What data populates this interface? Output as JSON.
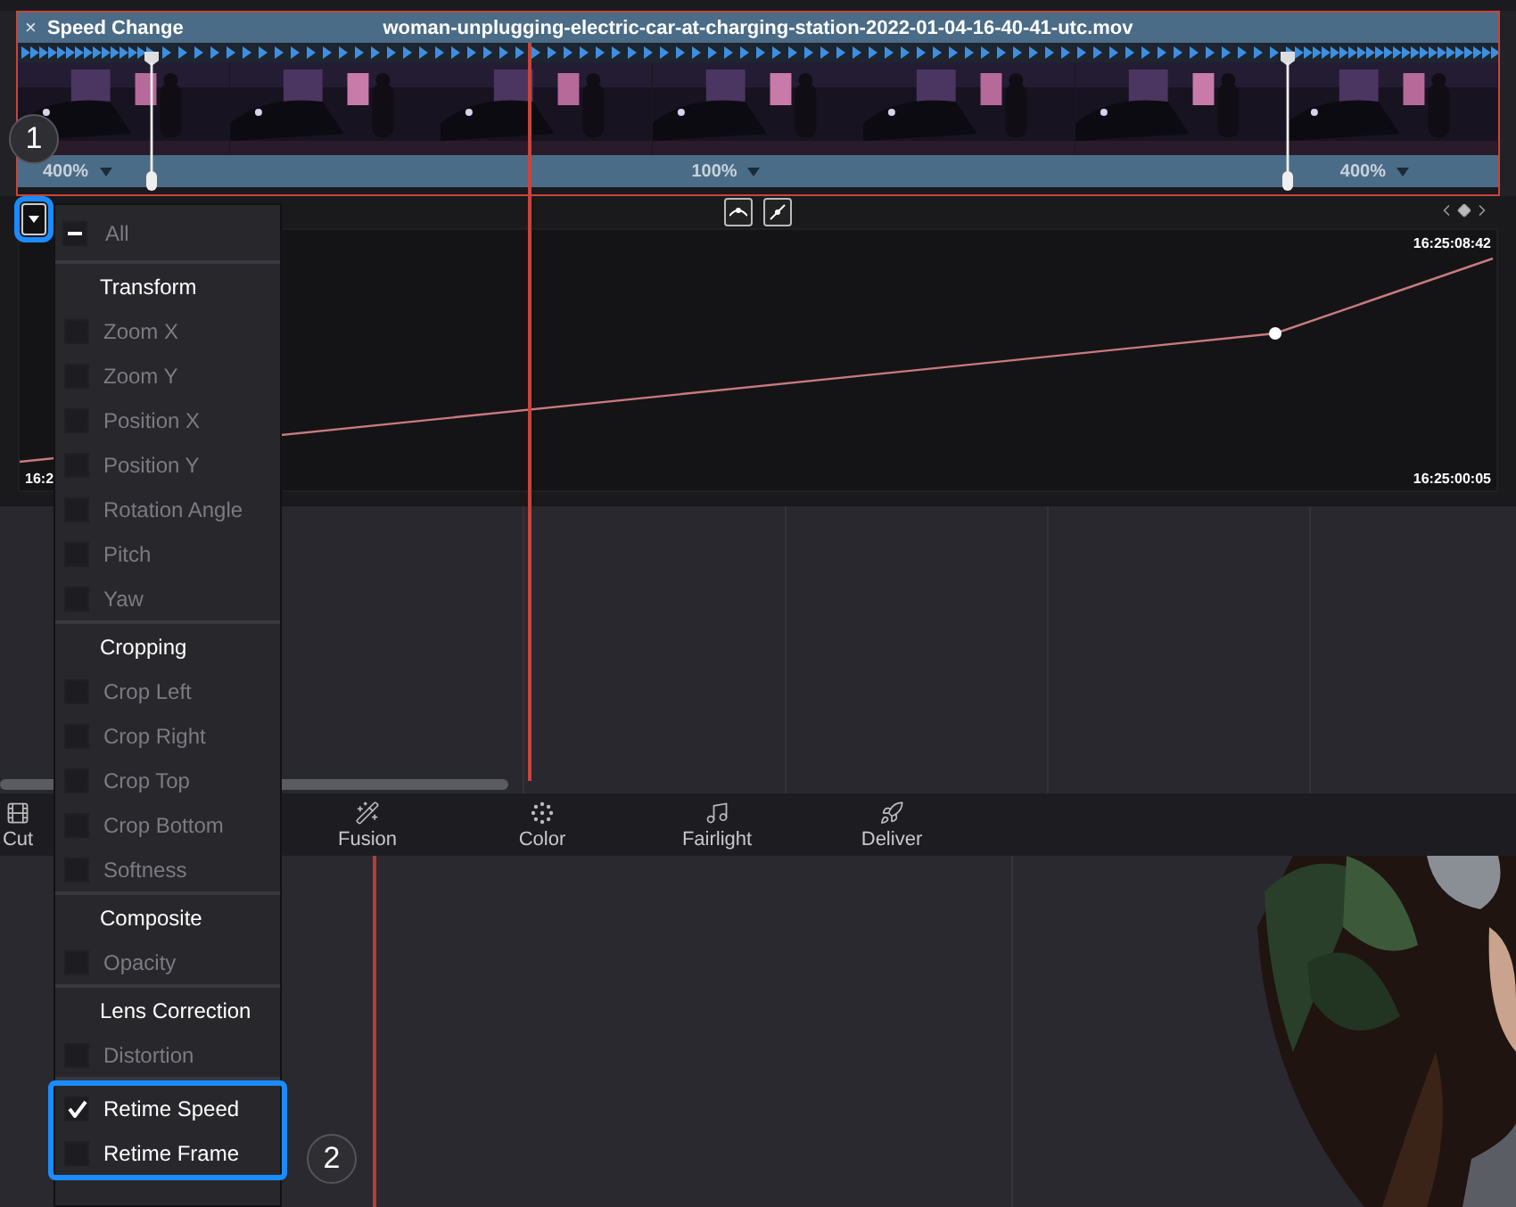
{
  "clip": {
    "close": "×",
    "title": "Speed Change",
    "filename": "woman-unplugging-electric-car-at-charging-station-2022-01-04-16-40-41-utc.mov",
    "speeds": [
      {
        "label": "400%"
      },
      {
        "label": "100%"
      },
      {
        "label": "400%"
      }
    ]
  },
  "curve_editor": {
    "time_top": "16:25:08:42",
    "time_bottom": "16:25:00:05",
    "time_left": "16:2"
  },
  "page_nav": [
    {
      "kind": "cut",
      "label": "Cut"
    },
    {
      "kind": "fusion",
      "label": "Fusion"
    },
    {
      "kind": "color",
      "label": "Color"
    },
    {
      "kind": "fairlight",
      "label": "Fairlight"
    },
    {
      "kind": "deliver",
      "label": "Deliver"
    }
  ],
  "menu_button": {
    "highlighted": true
  },
  "menu": {
    "all": {
      "label": "All",
      "indeterminate": true
    },
    "sections": [
      {
        "header": "Transform",
        "highlighted": false,
        "items": [
          {
            "label": "Zoom X",
            "checked": false,
            "disabled": true
          },
          {
            "label": "Zoom Y",
            "checked": false,
            "disabled": true
          },
          {
            "label": "Position X",
            "checked": false,
            "disabled": true
          },
          {
            "label": "Position Y",
            "checked": false,
            "disabled": true
          },
          {
            "label": "Rotation Angle",
            "checked": false,
            "disabled": true
          },
          {
            "label": "Pitch",
            "checked": false,
            "disabled": true
          },
          {
            "label": "Yaw",
            "checked": false,
            "disabled": true
          }
        ]
      },
      {
        "header": "Cropping",
        "highlighted": false,
        "items": [
          {
            "label": "Crop Left",
            "checked": false,
            "disabled": true
          },
          {
            "label": "Crop Right",
            "checked": false,
            "disabled": true
          },
          {
            "label": "Crop Top",
            "checked": false,
            "disabled": true
          },
          {
            "label": "Crop Bottom",
            "checked": false,
            "disabled": true
          },
          {
            "label": "Softness",
            "checked": false,
            "disabled": true
          }
        ]
      },
      {
        "header": "Composite",
        "highlighted": false,
        "items": [
          {
            "label": "Opacity",
            "checked": false,
            "disabled": true
          }
        ]
      },
      {
        "header": "Lens Correction",
        "highlighted": false,
        "items": [
          {
            "label": "Distortion",
            "checked": false,
            "disabled": true
          }
        ]
      },
      {
        "highlighted": true,
        "items": [
          {
            "label": "Retime Speed",
            "checked": true,
            "disabled": false
          },
          {
            "label": "Retime Frame",
            "checked": false,
            "disabled": false
          }
        ]
      }
    ]
  },
  "callouts": [
    {
      "label": "1"
    },
    {
      "label": "2"
    }
  ]
}
